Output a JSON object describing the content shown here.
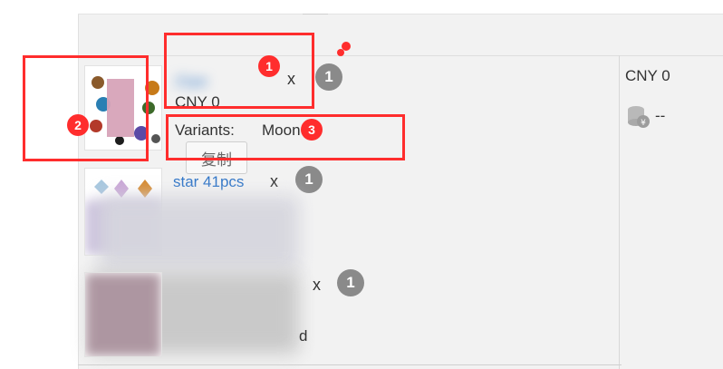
{
  "items": [
    {
      "title_visible": "21pc",
      "times": "x",
      "quantity": "1",
      "price": "CNY 0",
      "variants_label": "Variants:",
      "variants_value": "Moon",
      "copy_label": "复制"
    },
    {
      "title_visible": "star 41pcs",
      "times": "x",
      "quantity": "1"
    },
    {
      "title_visible": "",
      "times": "x",
      "quantity": "1",
      "trailing": "d"
    }
  ],
  "summary": {
    "total": "CNY 0",
    "cost_value": "--",
    "cost_icon": "coin-stack-icon"
  },
  "annotations": [
    {
      "label": "1"
    },
    {
      "label": "2"
    },
    {
      "label": "3"
    }
  ],
  "colors": {
    "annotation": "#ff2d2d",
    "link": "#2f75c7",
    "badge": "#8a8a8a"
  }
}
